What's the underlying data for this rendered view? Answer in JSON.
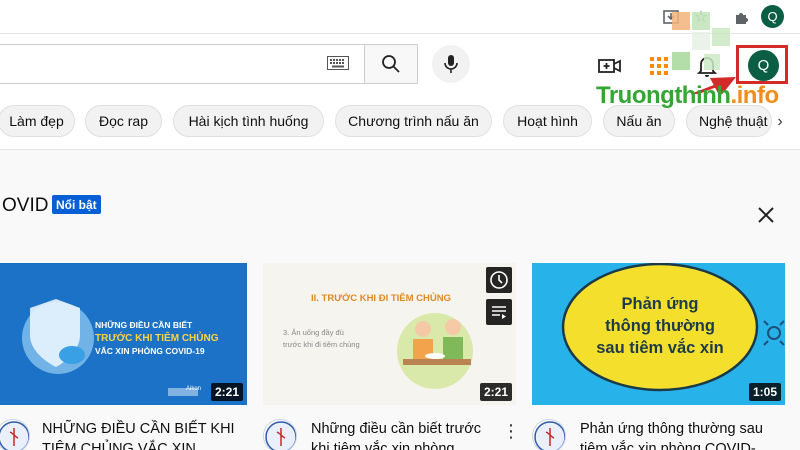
{
  "browser": {
    "profile_initial": "Q"
  },
  "masthead": {
    "search_placeholder": "",
    "avatar_initial": "Q"
  },
  "watermark": {
    "part1": "Truongthinh",
    "part2": ".info"
  },
  "chips": [
    {
      "label": "Làm đẹp"
    },
    {
      "label": "Đọc rap"
    },
    {
      "label": "Hài kịch tình huống"
    },
    {
      "label": "Chương trình nấu ăn"
    },
    {
      "label": "Hoạt hình"
    },
    {
      "label": "Nấu ăn"
    },
    {
      "label": "Nghệ thuật"
    }
  ],
  "shelf": {
    "title": "OVID",
    "badge": "Nổi bật"
  },
  "videos": [
    {
      "title_line1": "NHỮNG ĐIỀU CẦN BIẾT KHI",
      "title_line2": "TIÊM CHỦNG VẮC XIN",
      "duration": "2:21",
      "thumb": {
        "line1": "NHỮNG ĐIỀU CẦN BIẾT",
        "line2": "TRƯỚC KHI TIÊM CHỦNG",
        "line3": "VẮC XIN PHÒNG COVID-19",
        "brand": "Aikon"
      }
    },
    {
      "title_line1": "Những điều cần biết trước",
      "title_line2": "khi tiêm vắc xin phòng",
      "duration": "2:21",
      "thumb": {
        "heading": "II. TRƯỚC KHI ĐI TIÊM CHỦNG",
        "sub1": "3. Ăn uống đầy đủ",
        "sub2": "trước khi đi tiêm chủng"
      }
    },
    {
      "title_line1": "Phản ứng thông thường sau",
      "title_line2": "tiêm vắc xin phòng COVID-",
      "duration": "1:05",
      "thumb": {
        "line1": "Phản ứng",
        "line2": "thông thường",
        "line3": "sau tiêm vắc xin"
      }
    }
  ],
  "colors": {
    "avatar": "#0b5e44",
    "badge": "#065fd4",
    "highlight": "#d42a2a",
    "watermark_green": "#35a534",
    "watermark_orange": "#f28c1b"
  }
}
